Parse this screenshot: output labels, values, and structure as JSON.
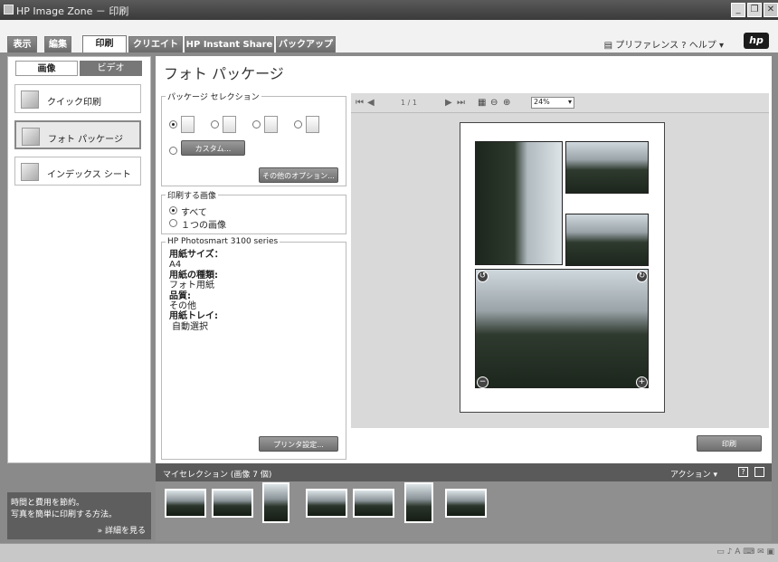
{
  "window": {
    "title": "HP Image Zone － 印刷"
  },
  "tabs": [
    {
      "label": "表示"
    },
    {
      "label": "編集"
    },
    {
      "label": "印刷"
    },
    {
      "label": "クリエイト"
    },
    {
      "label": "HP Instant Share"
    },
    {
      "label": "バックアップ"
    }
  ],
  "toplinks": {
    "preferences": "プリファレンス",
    "help": "ヘルプ"
  },
  "logo": {
    "text": "hp"
  },
  "left": {
    "media_tabs": [
      {
        "label": "画像"
      },
      {
        "label": "ビデオ"
      }
    ],
    "nav": [
      {
        "label": "クイック印刷"
      },
      {
        "label": "フォト パッケージ"
      },
      {
        "label": "インデックス シート"
      }
    ],
    "tip": {
      "line1": "時間と費用を節約。",
      "line2": "写真を簡単に印刷する方法。",
      "more": "» 詳細を見る"
    }
  },
  "main": {
    "title": "フォト パッケージ",
    "package": {
      "legend": "パッケージ セレクション",
      "custom_label": "カスタム...",
      "other_options": "その他のオプション..."
    },
    "print_images": {
      "legend": "印刷する画像",
      "opt_all": "すべて",
      "opt_one": "１つの画像"
    },
    "printer": {
      "legend": "HP Photosmart 3100 series",
      "paper_size_label": "用紙サイズ：",
      "paper_size_value": "A4",
      "paper_type_label": "用紙の種類:",
      "paper_type_value": "フォト用紙",
      "quality_label": "品質:",
      "quality_value": "その他",
      "tray_label": "用紙トレイ:",
      "tray_value": "自動選択"
    },
    "printer_settings": "プリンタ設定...",
    "viewer": {
      "page_counter": "1 / 1",
      "zoom": "24%"
    },
    "print_button": "印刷"
  },
  "myselection": {
    "label": "マイセレクション",
    "count": "(画像 7 個)",
    "actions": "アクション"
  }
}
